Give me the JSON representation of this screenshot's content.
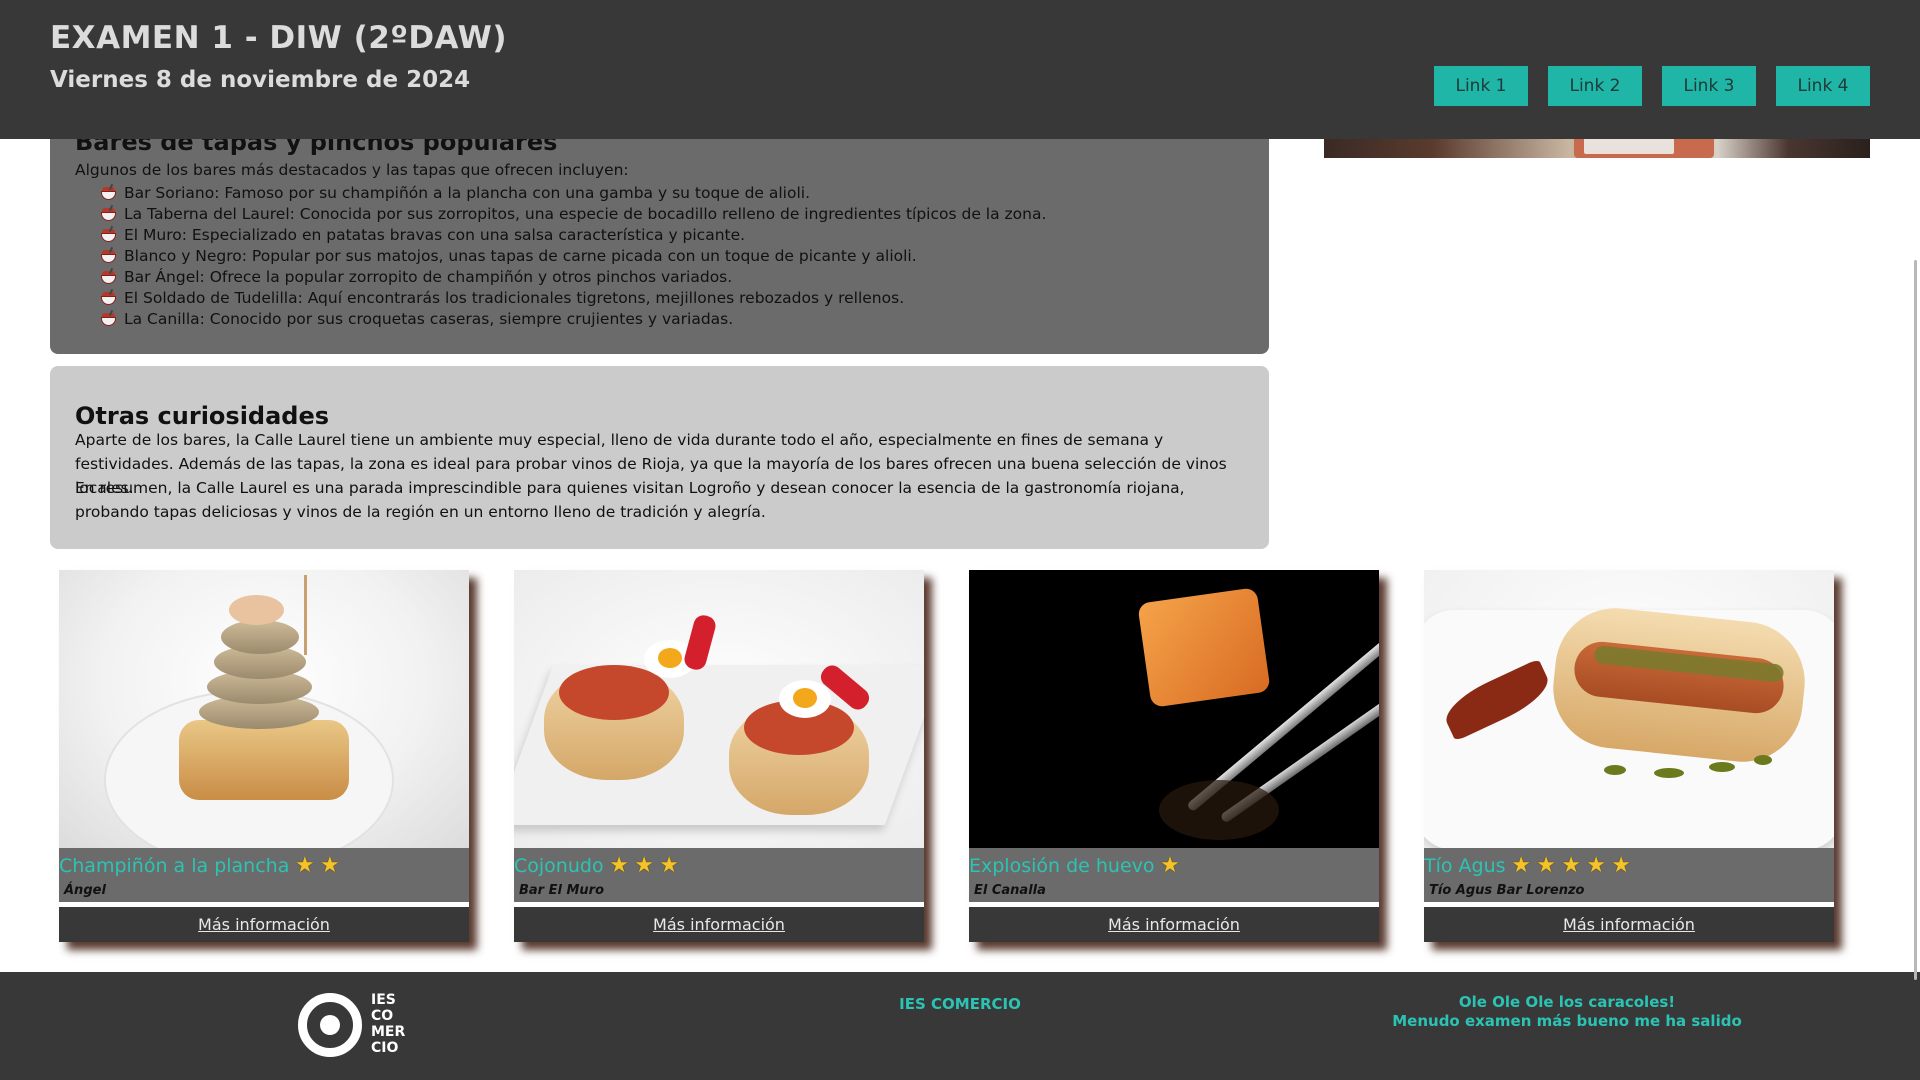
{
  "header": {
    "title": "EXAMEN 1 - DIW (2ºDAW)",
    "date": "Viernes 8 de noviembre de 2024",
    "nav": [
      "Link 1",
      "Link 2",
      "Link 3",
      "Link 4"
    ]
  },
  "bares": {
    "heading": "Bares de tapas y pinchos populares",
    "intro": "Algunos de los bares más destacados y las tapas que ofrecen incluyen:",
    "items": [
      "Bar Soriano: Famoso por su champiñón a la plancha con una gamba y su toque de alioli.",
      "La Taberna del Laurel: Conocida por sus zorropitos, una especie de bocadillo relleno de ingredientes típicos de la zona.",
      "El Muro: Especializado en patatas bravas con una salsa característica y picante.",
      "Blanco y Negro: Popular por sus matojos, unas tapas de carne picada con un toque de picante y alioli.",
      "Bar Ángel: Ofrece la popular zorropito de champiñón y otros pinchos variados.",
      "El Soldado de Tudelilla: Aquí encontrarás los tradicionales tigretons, mejillones rebozados y rellenos.",
      "La Canilla: Conocido por sus croquetas caseras, siempre crujientes y variadas."
    ],
    "item_icon": "bowl-icon"
  },
  "curiosidades": {
    "heading": "Otras curiosidades",
    "p1": "Aparte de los bares, la Calle Laurel tiene un ambiente muy especial, lleno de vida durante todo el año, especialmente en fines de semana y festividades. Además de las tapas, la zona es ideal para probar vinos de Rioja, ya que la mayoría de los bares ofrecen una buena selección de vinos locales.",
    "p2": "En resumen, la Calle Laurel es una parada imprescindible para quienes visitan Logroño y desean conocer la esencia de la gastronomía riojana, probando tapas deliciosas y vinos de la región en un entorno lleno de tradición y alegría."
  },
  "cards": [
    {
      "title": "Champiñón a la plancha",
      "stars": 2,
      "place": "Ángel",
      "button": "Más información"
    },
    {
      "title": "Cojonudo",
      "stars": 3,
      "place": "Bar El Muro",
      "button": "Más información"
    },
    {
      "title": "Explosión de huevo",
      "stars": 1,
      "place": "El Canalla",
      "button": "Más información"
    },
    {
      "title": "Tío Agus",
      "stars": 5,
      "place": "Tío Agus Bar Lorenzo",
      "button": "Más información"
    }
  ],
  "footer": {
    "logo_text": [
      "IES",
      "CO",
      "MER",
      "CIO"
    ],
    "center": "IES COMERCIO",
    "right_line1": "Ole Ole Ole los caracoles!",
    "right_line2": "Menudo examen más bueno me ha salido"
  },
  "colors": {
    "header_bg": "#383838",
    "accent": "#1fb5a7",
    "card_title": "#2bc4b4",
    "section_dark": "#6b6b6b",
    "section_light": "#cbcbcb",
    "star": "#f4c32a"
  }
}
